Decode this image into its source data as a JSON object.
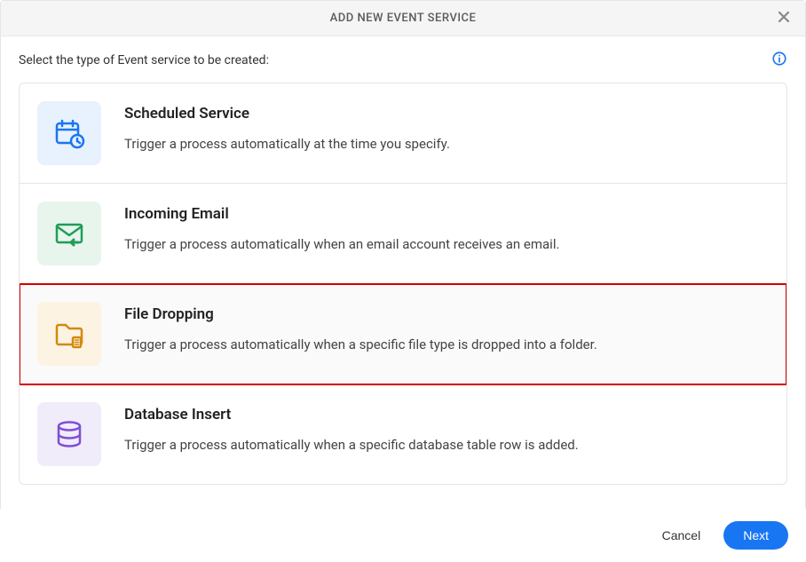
{
  "header": {
    "title": "ADD NEW EVENT SERVICE"
  },
  "prompt": "Select the type of Event service to be created:",
  "options": [
    {
      "title": "Scheduled Service",
      "desc": "Trigger a process automatically at the time you specify.",
      "icon": "scheduled",
      "color": "blue",
      "selected": false
    },
    {
      "title": "Incoming Email",
      "desc": "Trigger a process automatically when an email account receives an email.",
      "icon": "email",
      "color": "green",
      "selected": false
    },
    {
      "title": "File Dropping",
      "desc": "Trigger a process automatically when a specific file type is dropped into a folder.",
      "icon": "file",
      "color": "orange",
      "selected": true
    },
    {
      "title": "Database Insert",
      "desc": "Trigger a process automatically when a specific database table row is added.",
      "icon": "database",
      "color": "purple",
      "selected": false
    }
  ],
  "footer": {
    "cancel": "Cancel",
    "next": "Next"
  }
}
